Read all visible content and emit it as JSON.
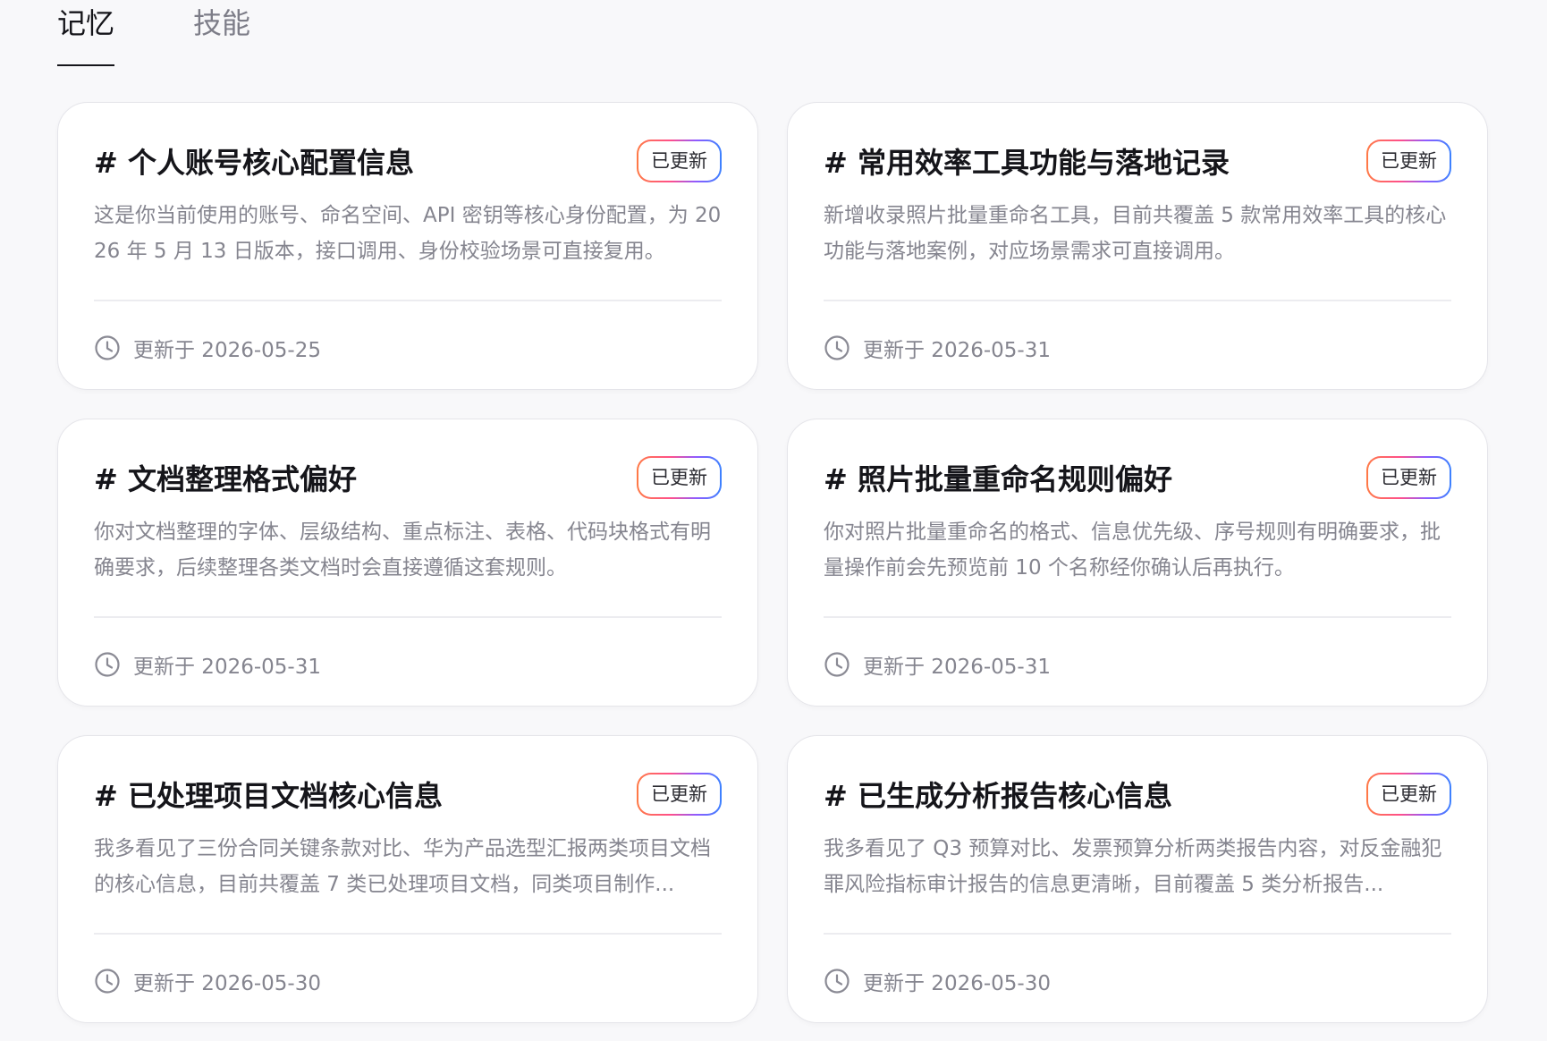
{
  "tabs": [
    {
      "label": "记忆",
      "active": true
    },
    {
      "label": "技能",
      "active": false
    }
  ],
  "cards": [
    {
      "title": "# 个人账号核心配置信息",
      "badge": "已更新",
      "desc": "这是你当前使用的账号、命名空间、API 密钥等核心身份配置，为 2026 年 5 月 13 日版本，接口调用、身份校验场景可直接复用。",
      "updated": "更新于 2026-05-25"
    },
    {
      "title": "# 常用效率工具功能与落地记录",
      "badge": "已更新",
      "desc": "新增收录照片批量重命名工具，目前共覆盖 5 款常用效率工具的核心功能与落地案例，对应场景需求可直接调用。",
      "updated": "更新于 2026-05-31"
    },
    {
      "title": "# 文档整理格式偏好",
      "badge": "已更新",
      "desc": "你对文档整理的字体、层级结构、重点标注、表格、代码块格式有明确要求，后续整理各类文档时会直接遵循这套规则。",
      "updated": "更新于 2026-05-31"
    },
    {
      "title": "# 照片批量重命名规则偏好",
      "badge": "已更新",
      "desc": "你对照片批量重命名的格式、信息优先级、序号规则有明确要求，批量操作前会先预览前 10 个名称经你确认后再执行。",
      "updated": "更新于 2026-05-31"
    },
    {
      "title": "# 已处理项目文档核心信息",
      "badge": "已更新",
      "desc": "我多看见了三份合同关键条款对比、华为产品选型汇报两类项目文档的核心信息，目前共覆盖 7 类已处理项目文档，同类项目制作...",
      "updated": "更新于 2026-05-30"
    },
    {
      "title": "# 已生成分析报告核心信息",
      "badge": "已更新",
      "desc": "我多看见了 Q3 预算对比、发票预算分析两类报告内容，对反金融犯罪风险指标审计报告的信息更清晰，目前覆盖 5 类分析报告...",
      "updated": "更新于 2026-05-30"
    }
  ]
}
